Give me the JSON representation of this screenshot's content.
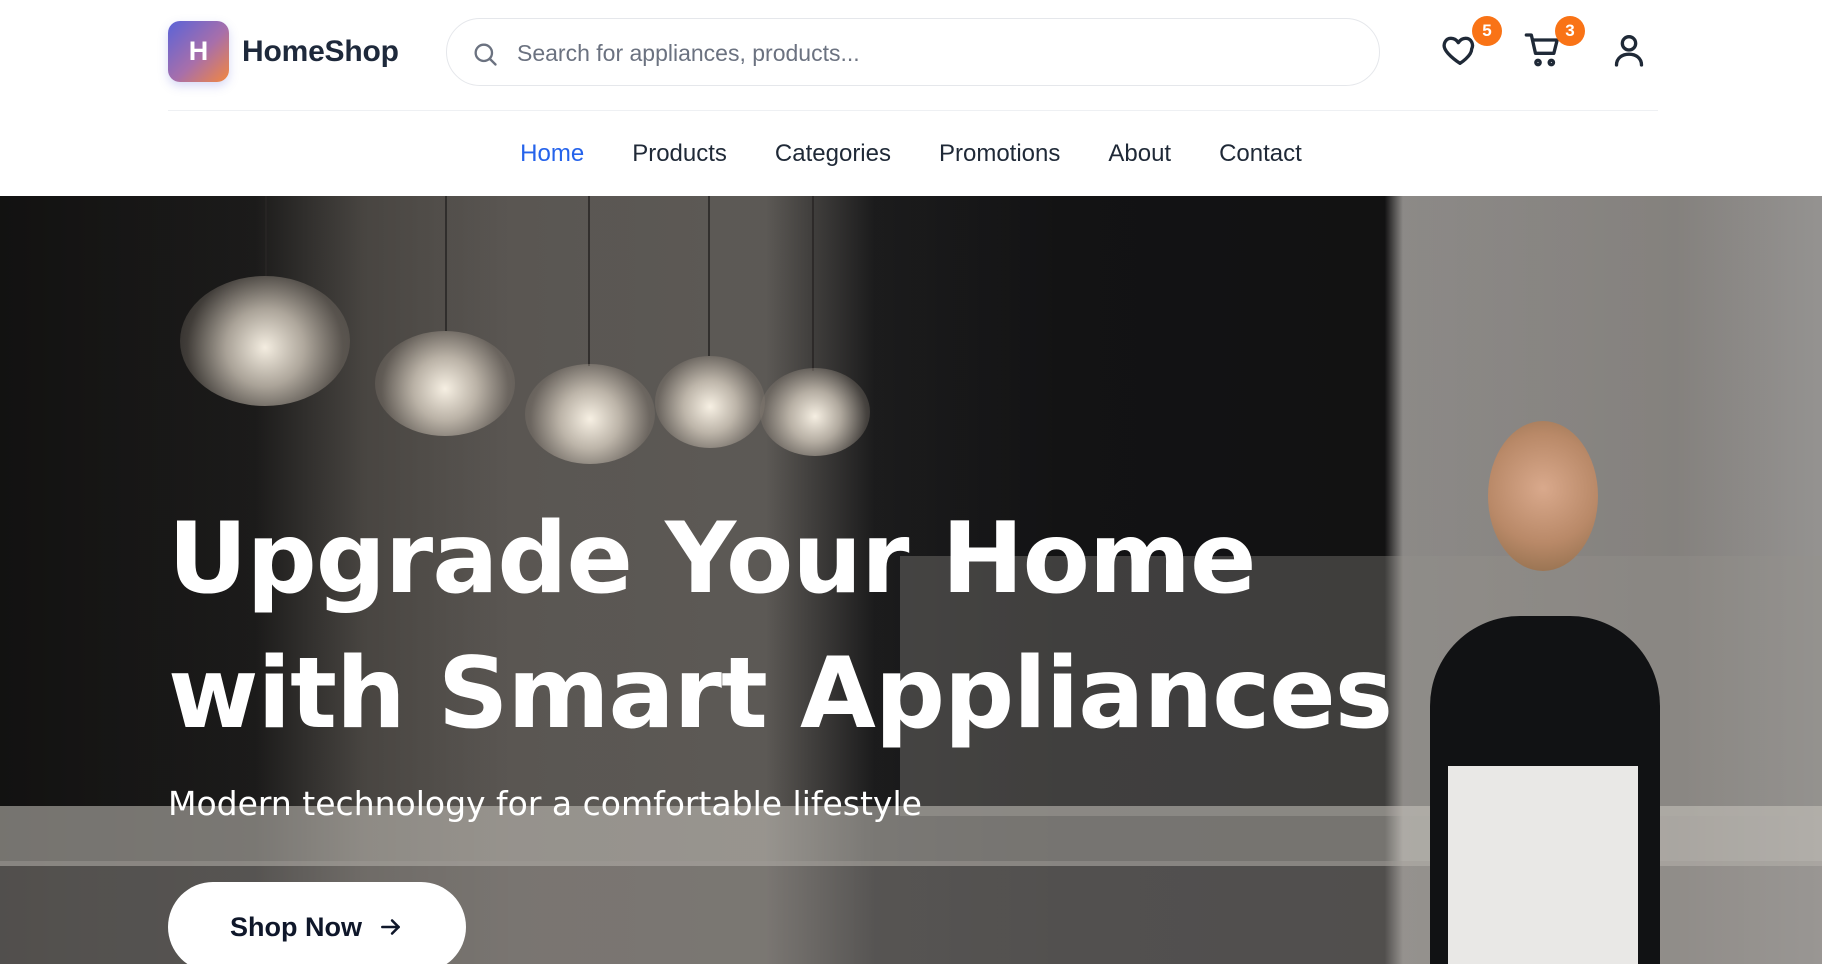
{
  "brand": {
    "initial": "H",
    "name": "HomeShop"
  },
  "search": {
    "placeholder": "Search for appliances, products..."
  },
  "header_actions": {
    "wishlist_count": "5",
    "cart_count": "3"
  },
  "nav": {
    "items": [
      {
        "label": "Home",
        "active": true
      },
      {
        "label": "Products"
      },
      {
        "label": "Categories"
      },
      {
        "label": "Promotions"
      },
      {
        "label": "About"
      },
      {
        "label": "Contact"
      }
    ]
  },
  "hero": {
    "title_line1": "Upgrade Your Home",
    "title_line2": "with Smart Appliances",
    "subtitle": "Modern technology for a comfortable lifestyle",
    "cta_label": "Shop Now"
  },
  "icons": [
    "search-icon",
    "heart-icon",
    "cart-icon",
    "user-icon",
    "arrow-right-icon"
  ],
  "colors": {
    "accent": "#2563eb",
    "badge": "#f97316",
    "logo_gradient_start": "#5a63d8",
    "logo_gradient_end": "#f3873e"
  }
}
